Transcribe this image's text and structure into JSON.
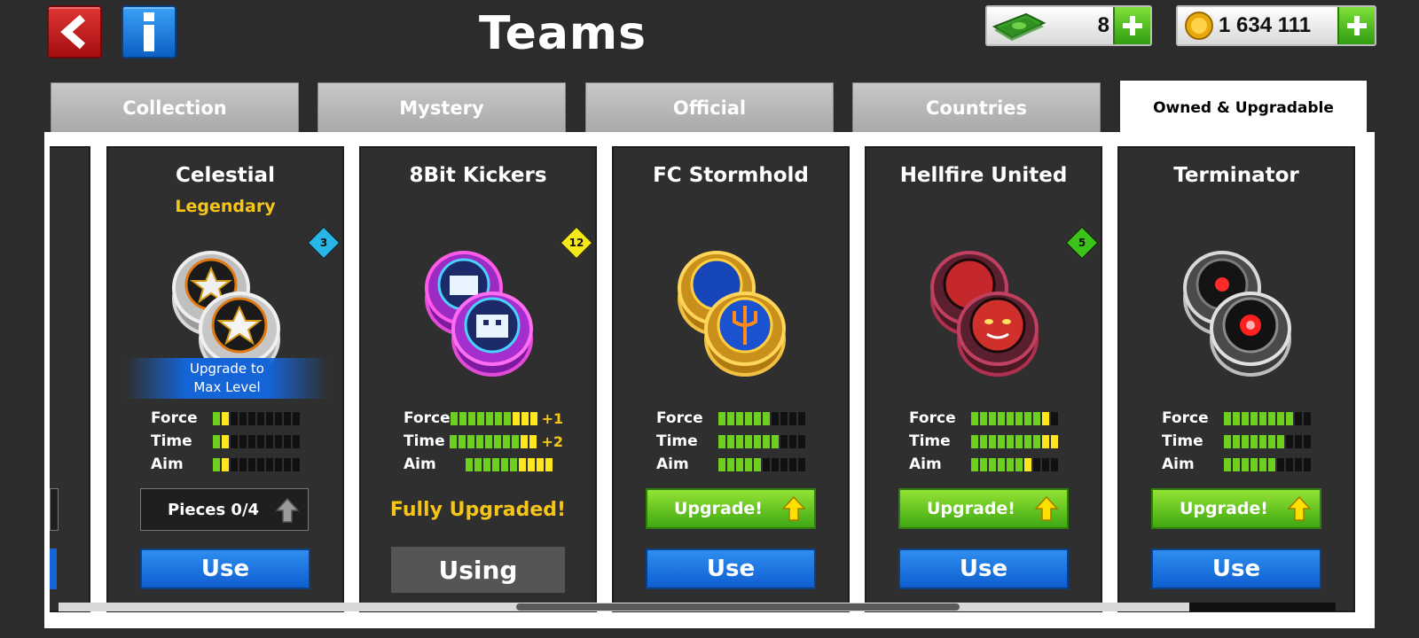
{
  "header": {
    "title": "Teams",
    "cash": {
      "value": "8",
      "icon": "cash-icon"
    },
    "coins": {
      "value": "1 634 111",
      "icon": "coin-icon"
    }
  },
  "tabs": [
    {
      "label": "Collection",
      "active": false
    },
    {
      "label": "Mystery",
      "active": false
    },
    {
      "label": "Official",
      "active": false
    },
    {
      "label": "Countries",
      "active": false
    },
    {
      "label": "Owned & Upgradable",
      "active": true
    }
  ],
  "cards": [
    {
      "name": "Celestial",
      "rarity": "Legendary",
      "badge": "3",
      "badge_color": "#27b6e6",
      "ribbon": [
        "Upgrade to",
        "Max Level"
      ],
      "stats": [
        {
          "label": "Force",
          "green": 1,
          "yellow": 1,
          "total": 10,
          "bonus": ""
        },
        {
          "label": "Time",
          "green": 1,
          "yellow": 1,
          "total": 10,
          "bonus": ""
        },
        {
          "label": "Aim",
          "green": 1,
          "yellow": 1,
          "total": 10,
          "bonus": ""
        }
      ],
      "action": "pieces",
      "pieces_label": "Pieces 0/4",
      "button": "Use"
    },
    {
      "name": "8Bit Kickers",
      "badge": "12",
      "badge_color": "#f5e81a",
      "stats": [
        {
          "label": "Force",
          "green": 7,
          "yellow": 3,
          "total": 10,
          "bonus": "+1"
        },
        {
          "label": "Time",
          "green": 8,
          "yellow": 2,
          "total": 10,
          "bonus": "+2"
        },
        {
          "label": "Aim",
          "green": 6,
          "yellow": 4,
          "total": 10,
          "bonus": ""
        }
      ],
      "action": "fully",
      "fully_label": "Fully Upgraded!",
      "button": "Using"
    },
    {
      "name": "FC Stormhold",
      "stats": [
        {
          "label": "Force",
          "green": 6,
          "yellow": 0,
          "total": 10,
          "bonus": ""
        },
        {
          "label": "Time",
          "green": 7,
          "yellow": 0,
          "total": 10,
          "bonus": ""
        },
        {
          "label": "Aim",
          "green": 5,
          "yellow": 0,
          "total": 10,
          "bonus": ""
        }
      ],
      "action": "upgrade",
      "upgrade_label": "Upgrade!",
      "button": "Use"
    },
    {
      "name": "Hellfire United",
      "badge": "5",
      "badge_color": "#3cc21a",
      "stats": [
        {
          "label": "Force",
          "green": 8,
          "yellow": 1,
          "total": 10,
          "bonus": ""
        },
        {
          "label": "Time",
          "green": 8,
          "yellow": 2,
          "total": 10,
          "bonus": ""
        },
        {
          "label": "Aim",
          "green": 6,
          "yellow": 1,
          "total": 10,
          "bonus": ""
        }
      ],
      "action": "upgrade",
      "upgrade_label": "Upgrade!",
      "button": "Use"
    },
    {
      "name": "Terminator",
      "stats": [
        {
          "label": "Force",
          "green": 8,
          "yellow": 0,
          "total": 10,
          "bonus": ""
        },
        {
          "label": "Time",
          "green": 7,
          "yellow": 0,
          "total": 10,
          "bonus": ""
        },
        {
          "label": "Aim",
          "green": 6,
          "yellow": 0,
          "total": 10,
          "bonus": ""
        }
      ],
      "action": "upgrade",
      "upgrade_label": "Upgrade!",
      "button": "Use"
    }
  ]
}
